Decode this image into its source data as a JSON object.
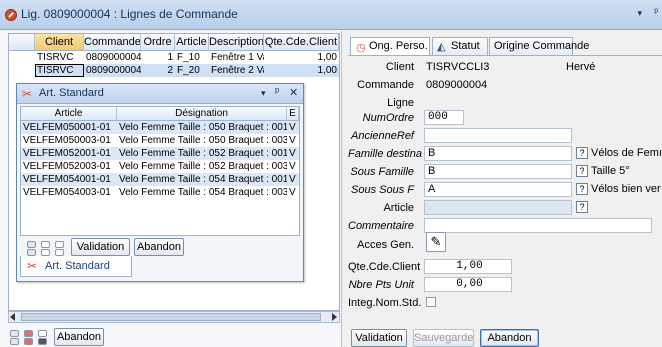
{
  "window": {
    "title": "Lig. 0809000004 : Lignes de Commande",
    "menu_arrow": "▾",
    "pin": "ᵖ"
  },
  "main_grid": {
    "columns": [
      "Client",
      "Commande",
      "Ordre",
      "Article",
      "Description",
      "Qte.Cde.Client"
    ],
    "rows": [
      {
        "client": "TISRVC",
        "commande": "0809000004",
        "ordre": "1",
        "article": "F_10",
        "description": "Fenêtre 1 Va",
        "qte": "1,00"
      },
      {
        "client": "TISRVC",
        "commande": "0809000004",
        "ordre": "2",
        "article": "F_20",
        "description": "Fenêtre 2 Va",
        "qte": "1,00"
      }
    ]
  },
  "float_window": {
    "title": "Art. Standard",
    "menu_arrow": "▾",
    "pin": "ᵖ",
    "close": "✕",
    "columns": [
      "Article",
      "Désignation",
      "E"
    ],
    "rows": [
      {
        "article": "VELFEM050001-01",
        "designation": "Velo Femme Taille : 050 Braquet : 001",
        "e": "V"
      },
      {
        "article": "VELFEM050003-01",
        "designation": "Velo Femme Taille : 050 Braquet : 003",
        "e": "V"
      },
      {
        "article": "VELFEM052001-01",
        "designation": "Velo Femme Taille : 052 Braquet : 001",
        "e": "V"
      },
      {
        "article": "VELFEM052003-01",
        "designation": "Velo Femme Taille : 052 Braquet : 003",
        "e": "V"
      },
      {
        "article": "VELFEM054001-01",
        "designation": "Velo Femme Taille : 054 Braquet : 001",
        "e": "V"
      },
      {
        "article": "VELFEM054003-01",
        "designation": "Velo Femme Taille : 054 Braquet : 003",
        "e": "V"
      }
    ],
    "validation_label": "Validation",
    "abandon_label": "Abandon",
    "tab_label": "Art. Standard"
  },
  "left_bottom": {
    "abandon_label": "Abandon"
  },
  "right_tabs": [
    "Ong. Perso.",
    "Statut",
    "Origine Commande"
  ],
  "form": {
    "client_label": "Client",
    "client_value": "TISRVCCLI3",
    "client_name": "Hervé",
    "commande_label": "Commande",
    "commande_value": "0809000004",
    "ligne_label": "Ligne",
    "numordre_label": "NumOrdre",
    "numordre_value": "000",
    "ancienneref_label": "AncienneRef",
    "ancienneref_value": "",
    "famille_label": "Famille destina",
    "famille_value": "B",
    "famille_desc": "Vélos de Femı",
    "sousfamille_label": "Sous Famille",
    "sousfamille_value": "B",
    "sousfamille_desc": "Taille 5°",
    "soussousf_label": "Sous Sous F",
    "soussousf_value": "A",
    "soussousf_desc": "Vélos bien ver",
    "article_label": "Article",
    "article_value": "",
    "commentaire_label": "Commentaire",
    "commentaire_value": "",
    "acces_label": "Acces Gen.",
    "qte_label": "Qte.Cde.Client",
    "qte_value": "1,00",
    "nbre_label": "Nbre Pts Unit",
    "nbre_value": "0,00",
    "integ_label": "Integ.Nom.Std.",
    "integ_checked": false,
    "help_glyph": "?"
  },
  "right_bottom": {
    "validation_label": "Validation",
    "sauvegarde_label": "Sauvegarde",
    "abandon_label": "Abandon"
  },
  "colors": {
    "selection": "#cfe0f5",
    "titlebar": "#c6d9f0",
    "accent_icon": "#d9482c"
  }
}
